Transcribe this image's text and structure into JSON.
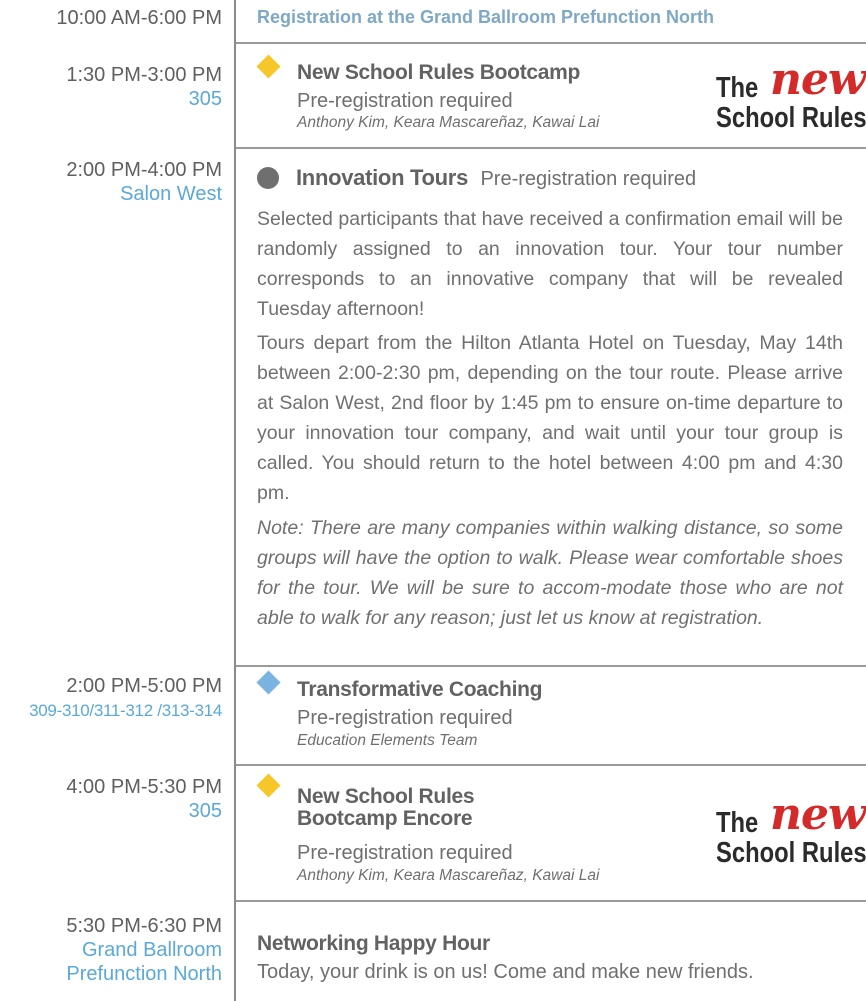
{
  "registration": {
    "time": "10:00 AM-6:00 PM",
    "text": "Registration at the Grand Ballroom Prefunction North"
  },
  "sessions": [
    {
      "time": "1:30 PM-3:00 PM",
      "room": "305",
      "marker": "yellow-diamond",
      "title": "New School Rules Bootcamp",
      "note": "Pre-registration required",
      "presenters": "Anthony Kim, Keara Mascareñaz, Kawai Lai",
      "logo": {
        "the": "The",
        "new": "new",
        "school_rules": "School Rules"
      }
    },
    {
      "time": "2:00 PM-4:00 PM",
      "room": "Salon West",
      "marker": "gray-circle",
      "title": "Innovation Tours",
      "note": "Pre-registration required",
      "paragraphs": [
        "Selected participants that have received a confirmation email will be randomly assigned to an innovation tour. Your tour number corresponds to an innovative company that will be revealed Tuesday afternoon!",
        "Tours depart from the Hilton Atlanta Hotel on Tuesday, May 14th between 2:00-2:30 pm, depending on the tour route. Please arrive at Salon West, 2nd floor by 1:45 pm to ensure on-time departure to your innovation tour company, and wait until your tour group is called. You should return to the hotel between 4:00 pm and 4:30 pm.",
        "Note: There are many companies within walking distance, so some groups will have the option to walk. Please wear comfortable shoes for the tour. We will be sure to accom-modate those who are not able to walk for any reason; just let us know at registration."
      ]
    },
    {
      "time": "2:00 PM-5:00 PM",
      "room": "309-310/311-312 /313-314",
      "marker": "blue-diamond",
      "title": "Transformative Coaching",
      "note": "Pre-registration required",
      "presenters": "Education Elements Team"
    },
    {
      "time": "4:00 PM-5:30 PM",
      "room": "305",
      "marker": "yellow-diamond",
      "title_line1": "New School Rules",
      "title_line2": "Bootcamp Encore",
      "note": "Pre-registration required",
      "presenters": "Anthony Kim, Keara Mascareñaz, Kawai Lai",
      "logo": {
        "the": "The",
        "new": "new",
        "school_rules": "School Rules"
      }
    },
    {
      "time": "5:30 PM-6:30 PM",
      "room_line1": "Grand Ballroom",
      "room_line2": "Prefunction North",
      "title": "Networking Happy Hour",
      "description": "Today, your drink is on us! Come and make new friends."
    }
  ],
  "colors": {
    "room_blue": "#5aa9d8",
    "diamond_yellow": "#f6c72a",
    "diamond_blue": "#7ab3df",
    "logo_red": "#d42a2a"
  }
}
